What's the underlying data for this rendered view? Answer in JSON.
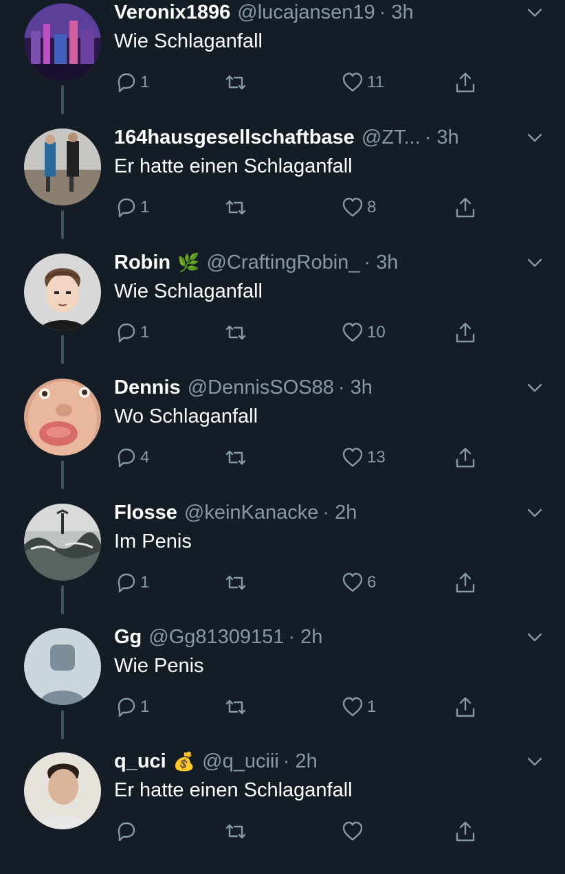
{
  "colors": {
    "background": "#141d26",
    "text": "#ffffff",
    "secondary": "#8899a6",
    "thread_line": "#3d5466"
  },
  "tweets": [
    {
      "name": "Veronix1896",
      "badge": "",
      "handle": "@lucajansen19",
      "time": "· 3h",
      "text": "Wie Schlaganfall",
      "replies": "1",
      "retweets": "",
      "likes": "11"
    },
    {
      "name": "164hausgesellschaftbase",
      "badge": "",
      "handle": "@ZT...",
      "time": "· 3h",
      "text": "Er hatte einen Schlaganfall",
      "replies": "1",
      "retweets": "",
      "likes": "8"
    },
    {
      "name": "Robin",
      "badge": "🌿",
      "handle": "@CraftingRobin_",
      "time": "· 3h",
      "text": "Wie Schlaganfall",
      "replies": "1",
      "retweets": "",
      "likes": "10"
    },
    {
      "name": "Dennis",
      "badge": "",
      "handle": "@DennisSOS88",
      "time": "· 3h",
      "text": "Wo Schlaganfall",
      "replies": "4",
      "retweets": "",
      "likes": "13"
    },
    {
      "name": "Flosse",
      "badge": "",
      "handle": "@keinKanacke",
      "time": "· 2h",
      "text": "Im Penis",
      "replies": "1",
      "retweets": "",
      "likes": "6"
    },
    {
      "name": "Gg",
      "badge": "",
      "handle": "@Gg81309151",
      "time": "· 2h",
      "text": "Wie Penis",
      "replies": "1",
      "retweets": "",
      "likes": "1"
    },
    {
      "name": "q_uci",
      "badge": "💰",
      "handle": "@q_uciii",
      "time": "· 2h",
      "text": "Er hatte einen Schlaganfall",
      "replies": "",
      "retweets": "",
      "likes": ""
    }
  ],
  "icons": {
    "reply": "reply-icon",
    "retweet": "retweet-icon",
    "like": "heart-icon",
    "share": "share-icon",
    "menu": "chevron-down-icon"
  }
}
